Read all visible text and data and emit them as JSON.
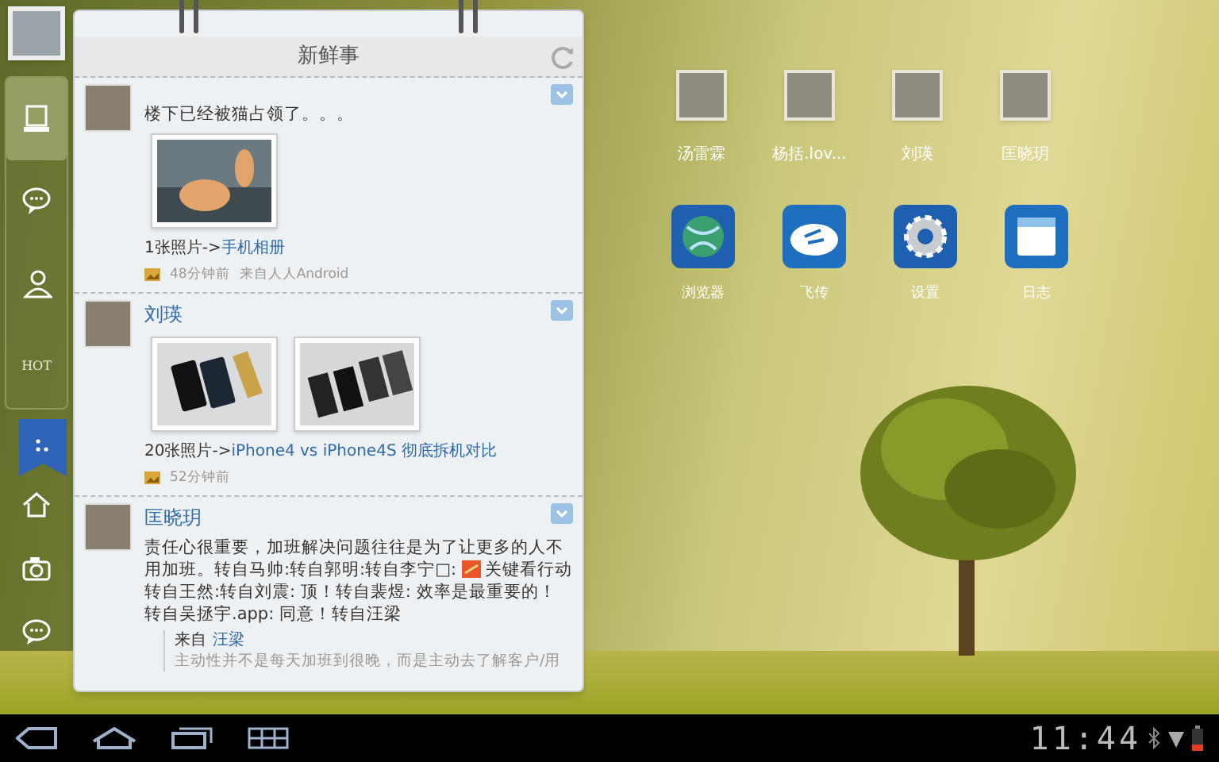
{
  "sidebar": {
    "tabs": [
      {
        "kind": "feed",
        "selected": true
      },
      {
        "kind": "chat",
        "selected": false
      },
      {
        "kind": "contacts",
        "selected": false
      },
      {
        "kind": "hot",
        "label": "HOT",
        "selected": false
      }
    ],
    "bottom_icons": [
      {
        "kind": "home"
      },
      {
        "kind": "camera"
      },
      {
        "kind": "chat"
      }
    ]
  },
  "feed": {
    "title": "新鲜事",
    "posts": [
      {
        "text": "楼下已经被猫占领了。。。",
        "photos": [
          {
            "kind": "cat"
          }
        ],
        "caption": {
          "prefix": "1张照片->",
          "link": "手机相册"
        },
        "meta": {
          "time": "48分钟前",
          "source": "来自人人Android"
        }
      },
      {
        "author": "刘瑛",
        "photos": [
          {
            "kind": "phones"
          },
          {
            "kind": "parts"
          }
        ],
        "caption": {
          "prefix": "20张照片->",
          "link": "iPhone4 vs iPhone4S 彻底拆机对比"
        },
        "meta": {
          "time": "52分钟前"
        }
      },
      {
        "author": "匡晓玥",
        "text": "责任心很重要，加班解决问题往往是为了让更多的人不用加班。转自马帅:转自郭明:转自李宁□:",
        "text_after_emoji": "关键看行动转自王然:转自刘震: 顶！转自裴煜: 效率是最重要的！转自吴拯宇.app: 同意！转自汪梁",
        "quote": {
          "prefix": "来自",
          "author": "汪梁",
          "text": "主动性并不是每天加班到很晚，而是主动去了解客户/用"
        }
      }
    ]
  },
  "contacts": [
    {
      "name": "汤雷霖"
    },
    {
      "name": "杨括.lov..."
    },
    {
      "name": "刘瑛"
    },
    {
      "name": "匡晓玥"
    }
  ],
  "apps": [
    {
      "kind": "browser",
      "label": "浏览器"
    },
    {
      "kind": "cloud",
      "label": "飞传"
    },
    {
      "kind": "settings",
      "label": "设置"
    },
    {
      "kind": "notes",
      "label": "日志"
    }
  ],
  "status_bar": {
    "time": "11:44"
  }
}
